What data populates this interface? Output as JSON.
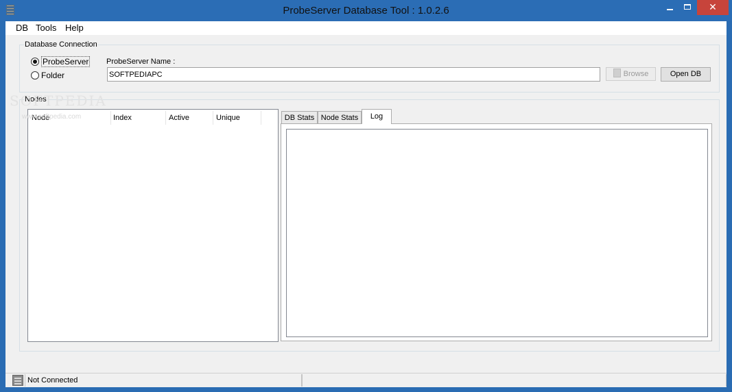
{
  "window": {
    "title": "ProbeServer Database Tool : 1.0.2.6",
    "close_glyph": "✕"
  },
  "menu": {
    "items": [
      "DB",
      "Tools",
      "Help"
    ]
  },
  "connection": {
    "group_label": "Database Connection",
    "radio_probeserver": "ProbeServer",
    "radio_folder": "Folder",
    "selected": "ProbeServer",
    "name_label": "ProbeServer Name :",
    "name_value": "SOFTPEDIAPC",
    "browse_label": "Browse",
    "open_label": "Open DB"
  },
  "nodes": {
    "group_label": "Nodes",
    "columns": [
      "Node",
      "Index",
      "Active",
      "Unique"
    ],
    "rows": []
  },
  "tabs": {
    "items": [
      "DB Stats",
      "Node Stats",
      "Log"
    ],
    "active": "Log"
  },
  "watermark": {
    "text": "SOFTPEDIA",
    "sub": "www.softpedia.com"
  },
  "status": {
    "text": "Not Connected"
  },
  "colors": {
    "titlebar": "#2b6db5",
    "close_button": "#c7443b",
    "window_bg": "#f0f0f0"
  }
}
